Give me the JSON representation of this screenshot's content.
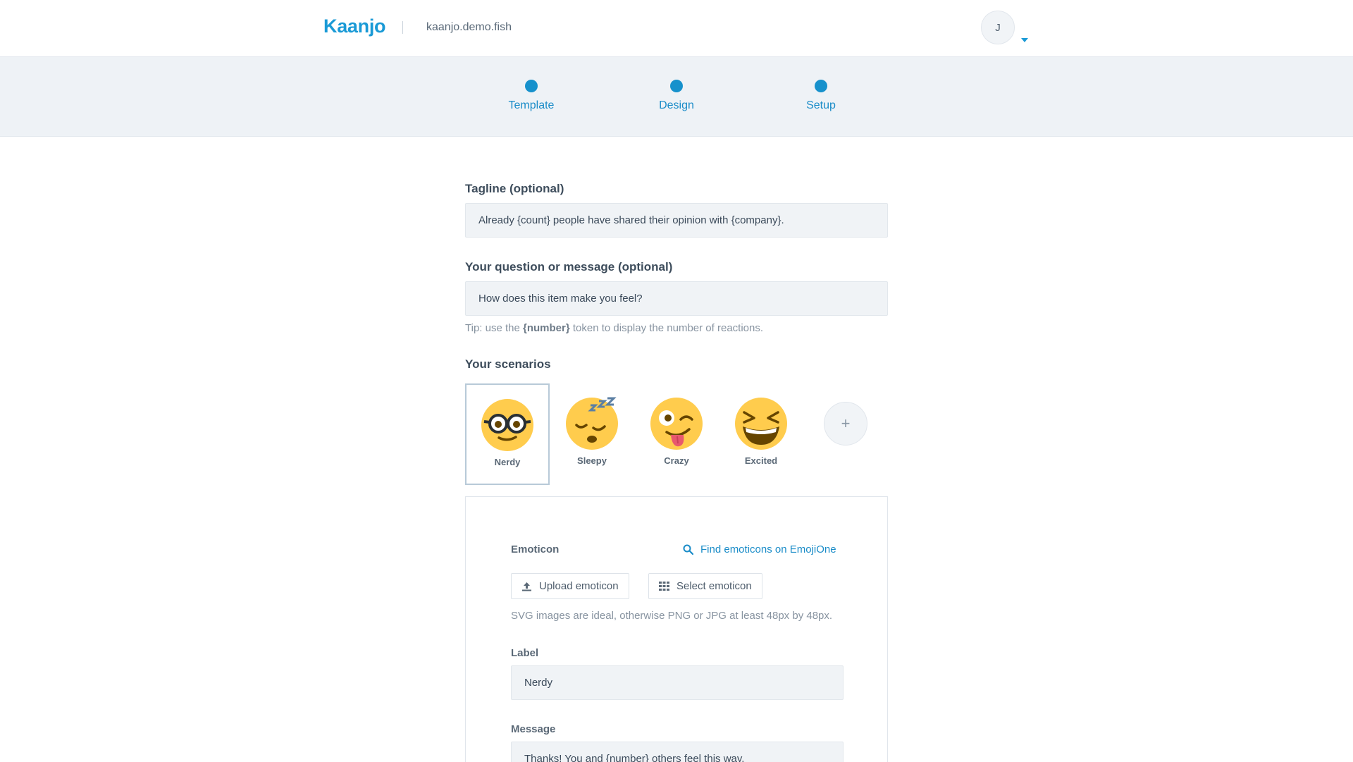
{
  "header": {
    "logo": "Kaanjo",
    "domain": "kaanjo.demo.fish",
    "avatar_initial": "J"
  },
  "steps": [
    {
      "label": "Template"
    },
    {
      "label": "Design"
    },
    {
      "label": "Setup"
    }
  ],
  "form": {
    "tagline_label": "Tagline (optional)",
    "tagline_value": "Already {count} people have shared their opinion with {company}.",
    "question_label": "Your question or message (optional)",
    "question_value": "How does this item make you feel?",
    "tip_prefix": "Tip: use the ",
    "tip_token": "{number}",
    "tip_suffix": " token to display the number of reactions.",
    "scenarios_label": "Your scenarios"
  },
  "scenarios": [
    {
      "label": "Nerdy",
      "icon": "nerd-face-emoji",
      "selected": true
    },
    {
      "label": "Sleepy",
      "icon": "sleeping-face-emoji",
      "selected": false
    },
    {
      "label": "Crazy",
      "icon": "winking-tongue-face-emoji",
      "selected": false
    },
    {
      "label": "Excited",
      "icon": "grinning-squinting-face-emoji",
      "selected": false
    }
  ],
  "add_scenario": "+",
  "editor": {
    "emoticon_label": "Emoticon",
    "find_link": "Find emoticons on EmojiOne",
    "upload_button": "Upload emoticon",
    "select_button": "Select emoticon",
    "image_hint": "SVG images are ideal, otherwise PNG or JPG at least 48px by 48px.",
    "label_label": "Label",
    "label_value": "Nerdy",
    "message_label": "Message",
    "message_value": "Thanks! You and {number} others feel this way."
  },
  "colors": {
    "accent": "#1a9ad6",
    "emoji_yellow": "#ffcc4d"
  }
}
